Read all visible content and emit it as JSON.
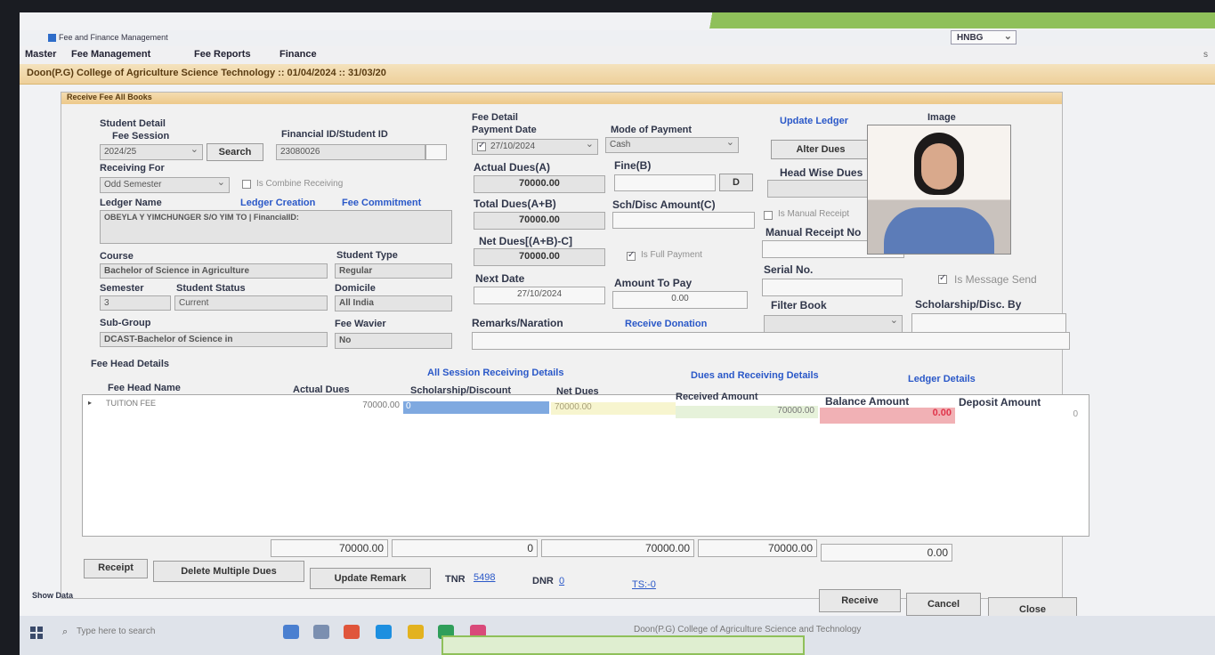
{
  "window": {
    "title": "Fee and Finance Management",
    "user": "HNBG"
  },
  "menu": [
    "Master",
    "Fee Management",
    "Fee Reports",
    "Finance"
  ],
  "menu_right": "s",
  "college_bar": "Doon(P.G) College of Agriculture Science Technology :: 01/04/2024 :: 31/03/20",
  "panel_title": "Receive Fee All Books",
  "student": {
    "section": "Student Detail",
    "fee_session_label": "Fee Session",
    "fee_session_value": "2024/25",
    "search_label": "Search",
    "financial_id_label": "Financial ID/Student ID",
    "financial_id_value": "23080026",
    "receiving_for_label": "Receiving For",
    "receiving_for_value": "Odd Semester",
    "combine_label": "Is Combine Receiving",
    "ledger_name_label": "Ledger Name",
    "ledger_creation_link": "Ledger Creation",
    "fee_commitment_link": "Fee Commitment",
    "ledger_name_value": "OBEYLA Y YIMCHUNGER S/O YIM TO | FinancialID:",
    "course_label": "Course",
    "course_value": "Bachelor of Science in Agriculture",
    "student_type_label": "Student Type",
    "student_type_value": "Regular",
    "semester_label": "Semester",
    "semester_value": "3",
    "status_label": "Student Status",
    "status_value": "Current",
    "domicile_label": "Domicile",
    "domicile_value": "All India",
    "subgroup_label": "Sub-Group",
    "subgroup_value": "DCAST-Bachelor of Science in",
    "fee_wavier_label": "Fee Wavier",
    "fee_wavier_value": "No"
  },
  "fee": {
    "section": "Fee Detail",
    "payment_date_label": "Payment Date",
    "payment_date_value": "27/10/2024",
    "mode_label": "Mode of Payment",
    "mode_value": "Cash",
    "actual_dues_label": "Actual Dues(A)",
    "actual_dues_value": "70000.00",
    "fine_label": "Fine(B)",
    "fine_btn": "D",
    "total_dues_label": "Total Dues(A+B)",
    "total_dues_value": "70000.00",
    "sch_disc_label": "Sch/Disc Amount(C)",
    "net_dues_label": "Net Dues[(A+B)-C]",
    "net_dues_value": "70000.00",
    "full_payment_label": "Is Full Payment",
    "next_date_label": "Next Date",
    "next_date_value": "27/10/2024",
    "amount_to_pay_label": "Amount To Pay",
    "amount_to_pay_value": "0.00",
    "remarks_label": "Remarks/Naration",
    "receive_donation_link": "Receive Donation"
  },
  "right": {
    "update_ledger_link": "Update Ledger",
    "alter_dues_btn": "Alter Dues",
    "head_wise_dues_label": "Head Wise Dues",
    "manual_receipt_chk": "Is Manual Receipt",
    "manual_receipt_no_label": "Manual Receipt No",
    "serial_no_label": "Serial No.",
    "filter_book_label": "Filter Book",
    "image_label": "Image",
    "message_send_label": "Is Message Send",
    "scholarship_by_label": "Scholarship/Disc. By"
  },
  "fee_head": {
    "section": "Fee Head Details",
    "all_session_link": "All Session Receiving Details",
    "dues_receiving_link": "Dues and Receiving Details",
    "ledger_details_link": "Ledger Details",
    "columns": [
      "Fee Head Name",
      "Actual Dues",
      "Scholarship/Discount",
      "Net Dues",
      "Received Amount",
      "Balance Amount",
      "Deposit Amount"
    ],
    "row": {
      "marker": "▸",
      "name": "TUITION FEE",
      "actual": "70000.00",
      "scholarship": "0",
      "net": "70000.00",
      "received": "70000.00",
      "balance": "0.00",
      "deposit": "0"
    }
  },
  "totals": {
    "actual": "70000.00",
    "scholarship": "0",
    "net": "70000.00",
    "received": "70000.00",
    "balance": "0.00"
  },
  "bottom": {
    "receipt_btn": "Receipt",
    "delete_btn": "Delete Multiple Dues",
    "update_remark_btn": "Update Remark",
    "tnr_label": "TNR",
    "tnr_value": "5498",
    "dnr_label": "DNR",
    "dnr_value": "0",
    "ts_link": "TS:-0",
    "receive_btn": "Receive",
    "cancel_btn": "Cancel",
    "close_btn": "Close",
    "show_data": "Show Data"
  },
  "taskbar": {
    "search_placeholder": "Type here to search",
    "window_caption": "Doon(P.G) College of Agriculture Science and Technology",
    "app_colors": [
      "#4a7fd0",
      "#7b8fb0",
      "#e0553b",
      "#1d8fe0",
      "#e3b21f",
      "#2f9e5a",
      "#d94a7a"
    ]
  },
  "colors": {
    "balance_highlight": "#f1b1b5",
    "scholarship_highlight": "#7fa9e0",
    "net_highlight": "#f7f5cf",
    "received_highlight": "#e6f2da",
    "menu_band": "#eed09b",
    "accent_green": "#8fc05a"
  }
}
